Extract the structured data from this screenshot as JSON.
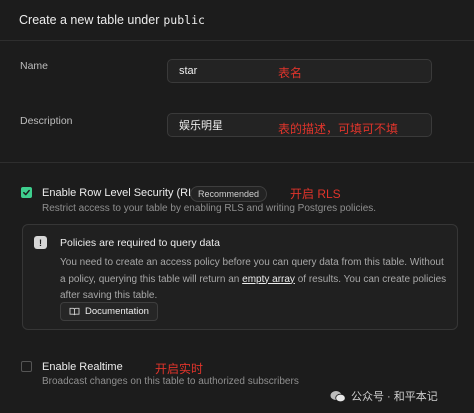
{
  "header": {
    "title": "Create a new table under",
    "schema": "public"
  },
  "name": {
    "label": "Name",
    "value": "star",
    "annotation": "表名"
  },
  "description": {
    "label": "Description",
    "value": "娱乐明星",
    "annotation": "表的描述，可填可不填"
  },
  "rls": {
    "title": "Enable Row Level Security (RLS)",
    "badge": "Recommended",
    "annotation": "开启 RLS",
    "description": "Restrict access to your table by enabling RLS and writing Postgres policies.",
    "checked": true
  },
  "notice": {
    "title": "Policies are required to query data",
    "body_part1": "You need to create an access policy before you can query data from this table. Without a policy, querying this table will return an ",
    "body_link": "empty array",
    "body_part2": " of results. You can create policies after saving this table.",
    "button_label": "Documentation"
  },
  "realtime": {
    "title": "Enable Realtime",
    "annotation": "开启实时",
    "description": "Broadcast changes on this table to authorized subscribers",
    "checked": false
  },
  "watermark": "公众号 · 和平本记",
  "colors": {
    "accent": "#3ecf8e",
    "annotation": "#e0342b",
    "background": "#1c1c1c"
  }
}
